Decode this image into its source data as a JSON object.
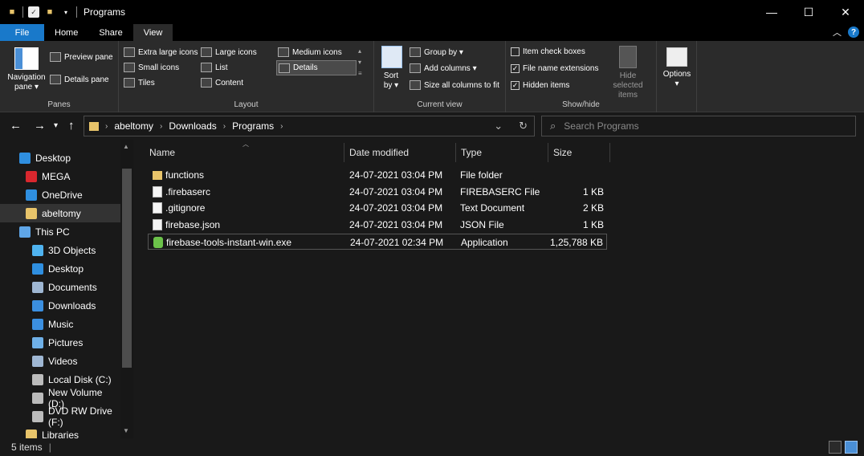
{
  "window": {
    "title": "Programs",
    "controls": {
      "minimize": "—",
      "maximize": "☐",
      "close": "✕"
    }
  },
  "ribbon_tabs": [
    {
      "label": "File"
    },
    {
      "label": "Home"
    },
    {
      "label": "Share"
    },
    {
      "label": "View"
    }
  ],
  "ribbon": {
    "panes": {
      "label": "Panes",
      "navigation_pane": "Navigation pane ▾",
      "preview_pane": "Preview pane",
      "details_pane": "Details pane"
    },
    "layout": {
      "label": "Layout",
      "extra_large_icons": "Extra large icons",
      "large_icons": "Large icons",
      "medium_icons": "Medium icons",
      "small_icons": "Small icons",
      "list": "List",
      "details": "Details",
      "tiles": "Tiles",
      "content": "Content"
    },
    "current_view": {
      "label": "Current view",
      "sort_by": "Sort by ▾",
      "group_by": "Group by ▾",
      "add_columns": "Add columns ▾",
      "size_all_columns": "Size all columns to fit"
    },
    "show_hide": {
      "label": "Show/hide",
      "item_check_boxes": "Item check boxes",
      "file_name_extensions": "File name extensions",
      "hidden_items": "Hidden items",
      "hide_selected_items": "Hide selected items"
    },
    "options": {
      "label": "Options ▾"
    }
  },
  "address": {
    "crumbs": [
      "abeltomy",
      "Downloads",
      "Programs"
    ]
  },
  "search": {
    "placeholder": "Search Programs"
  },
  "sidebar": {
    "items": [
      {
        "label": "Desktop",
        "icon": "desktop-icon",
        "color": "#2f8fe0"
      },
      {
        "label": "MEGA",
        "icon": "mega-icon",
        "color": "#d9272e"
      },
      {
        "label": "OneDrive",
        "icon": "cloud-icon",
        "color": "#2f8fe0"
      },
      {
        "label": "abeltomy",
        "icon": "user-folder-icon",
        "color": "#e8c46a"
      },
      {
        "label": "This PC",
        "icon": "computer-icon",
        "color": "#5fa6e8"
      },
      {
        "label": "3D Objects",
        "icon": "cube-icon",
        "color": "#4fb3f0"
      },
      {
        "label": "Desktop",
        "icon": "desktop-icon",
        "color": "#2f8fe0"
      },
      {
        "label": "Documents",
        "icon": "document-icon",
        "color": "#9fb7d3"
      },
      {
        "label": "Downloads",
        "icon": "download-icon",
        "color": "#3b8fe0"
      },
      {
        "label": "Music",
        "icon": "music-icon",
        "color": "#3b8fe0"
      },
      {
        "label": "Pictures",
        "icon": "picture-icon",
        "color": "#6fb0e8"
      },
      {
        "label": "Videos",
        "icon": "video-icon",
        "color": "#9fb7d3"
      },
      {
        "label": "Local Disk (C:)",
        "icon": "drive-icon",
        "color": "#bbbbbb"
      },
      {
        "label": "New Volume (D:)",
        "icon": "drive-icon",
        "color": "#bbbbbb"
      },
      {
        "label": "DVD RW Drive (F:)",
        "icon": "dvd-icon",
        "color": "#bbbbbb"
      },
      {
        "label": "Libraries",
        "icon": "library-icon",
        "color": "#e8c46a"
      }
    ]
  },
  "columns": {
    "name": "Name",
    "date": "Date modified",
    "type": "Type",
    "size": "Size"
  },
  "files": [
    {
      "name": "functions",
      "date": "24-07-2021 03:04 PM",
      "type": "File folder",
      "size": "",
      "icon": "folder-icon"
    },
    {
      "name": ".firebaserc",
      "date": "24-07-2021 03:04 PM",
      "type": "FIREBASERC File",
      "size": "1 KB",
      "icon": "file-icon"
    },
    {
      "name": ".gitignore",
      "date": "24-07-2021 03:04 PM",
      "type": "Text Document",
      "size": "2 KB",
      "icon": "file-icon"
    },
    {
      "name": "firebase.json",
      "date": "24-07-2021 03:04 PM",
      "type": "JSON File",
      "size": "1 KB",
      "icon": "file-icon"
    },
    {
      "name": "firebase-tools-instant-win.exe",
      "date": "24-07-2021 02:34 PM",
      "type": "Application",
      "size": "1,25,788 KB",
      "icon": "node-app-icon"
    }
  ],
  "status": {
    "count": "5 items"
  }
}
